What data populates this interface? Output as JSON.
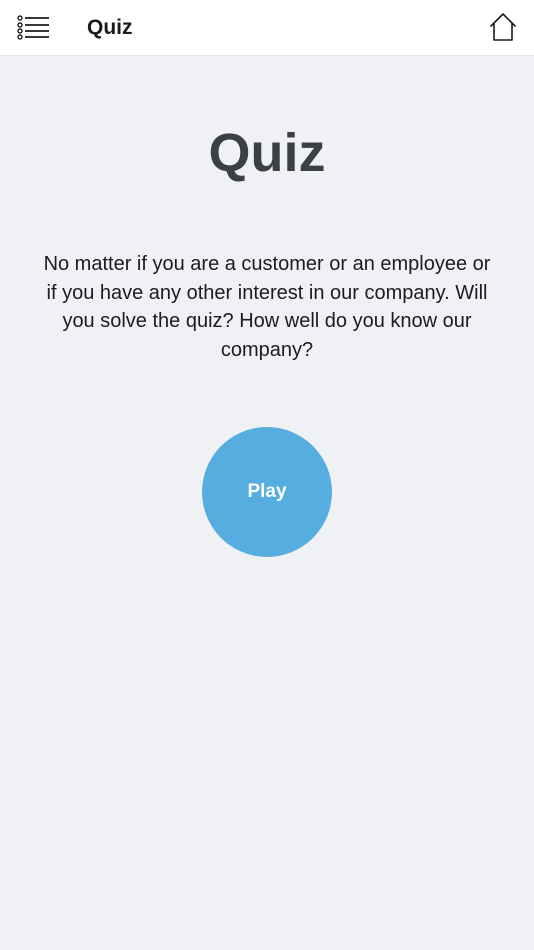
{
  "header": {
    "title": "Quiz",
    "menu_icon": "menu-list-icon",
    "home_icon": "home-icon"
  },
  "main": {
    "heading": "Quiz",
    "description": "No matter if you are a customer or an employee or if you have any other interest in our company. Will you solve the quiz? How well do you know our company?",
    "play_label": "Play"
  },
  "colors": {
    "background": "#eff1f5",
    "header_background": "#ffffff",
    "play_button": "#56ade0",
    "heading_text": "#3c3f45"
  }
}
